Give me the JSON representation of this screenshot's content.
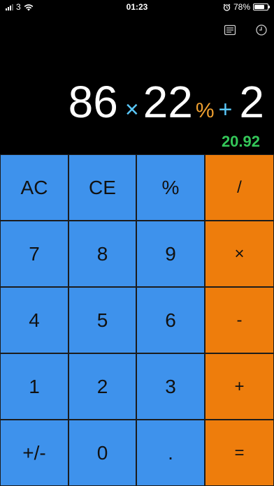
{
  "status_bar": {
    "carrier": "3",
    "time": "01:23",
    "battery_percent": "78%",
    "battery_level": 0.78
  },
  "toolbar": {
    "left_icon": "list-icon",
    "right_icon": "history-clock-icon"
  },
  "display": {
    "expression": {
      "num1": "86",
      "op1": "×",
      "num2": "22",
      "op2": "%",
      "op3": "+",
      "num3": "2"
    },
    "result": "20.92"
  },
  "keypad": {
    "ac": "AC",
    "ce": "CE",
    "percent": "%",
    "divide": "/",
    "seven": "7",
    "eight": "8",
    "nine": "9",
    "multiply": "×",
    "four": "4",
    "five": "5",
    "six": "6",
    "minus": "-",
    "one": "1",
    "two": "2",
    "three": "3",
    "plus": "+",
    "sign": "+/-",
    "zero": "0",
    "decimal": ".",
    "equals": "="
  },
  "colors": {
    "number_key": "#3e92ec",
    "operator_key": "#ee7d0c",
    "result_green": "#34c759",
    "operator_blue": "#5ac8fa",
    "percent_orange": "#f0a030",
    "background": "#000000"
  }
}
